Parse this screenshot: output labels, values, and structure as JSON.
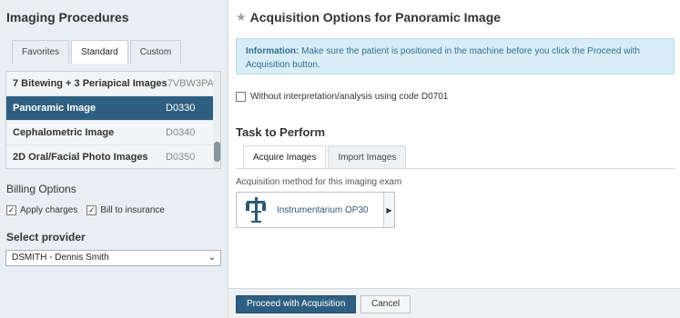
{
  "left": {
    "title": "Imaging Procedures",
    "tabs": [
      {
        "label": "Favorites",
        "active": false
      },
      {
        "label": "Standard",
        "active": true
      },
      {
        "label": "Custom",
        "active": false
      }
    ],
    "procedures": [
      {
        "name": "7 Bitewing + 3 Periapical Images",
        "code": "7VBW3PA",
        "selected": false
      },
      {
        "name": "Panoramic Image",
        "code": "D0330",
        "selected": true
      },
      {
        "name": "Cephalometric Image",
        "code": "D0340",
        "selected": false
      },
      {
        "name": "2D Oral/Facial Photo Images",
        "code": "D0350",
        "selected": false
      }
    ],
    "billing": {
      "label": "Billing Options",
      "apply_charges": {
        "label": "Apply charges",
        "checked": true
      },
      "bill_insurance": {
        "label": "Bill to insurance",
        "checked": true
      }
    },
    "provider": {
      "label": "Select provider",
      "value": "DSMITH - Dennis Smith"
    }
  },
  "right": {
    "title": "Acquisition Options for Panoramic Image",
    "info": {
      "prefix": "Information:",
      "text": " Make sure the patient is positioned in the machine before you click the Proceed with Acquisition button."
    },
    "interpretation": {
      "label": "Without interpretation/analysis using code D0701",
      "checked": false
    },
    "task_title": "Task to Perform",
    "tabs": [
      {
        "label": "Acquire Images",
        "active": true
      },
      {
        "label": "Import Images",
        "active": false
      }
    ],
    "acquisition_label": "Acquisition method for this imaging exam",
    "device": {
      "name": "Instrumentarium OP30",
      "icon": "panoramic-xray-machine-icon"
    }
  },
  "footer": {
    "proceed": "Proceed with Acquisition",
    "cancel": "Cancel"
  },
  "colors": {
    "selected_row": "#2e5f80",
    "info_bg": "#d9edf7",
    "info_text": "#31708f",
    "primary_button": "#2e5f80"
  }
}
